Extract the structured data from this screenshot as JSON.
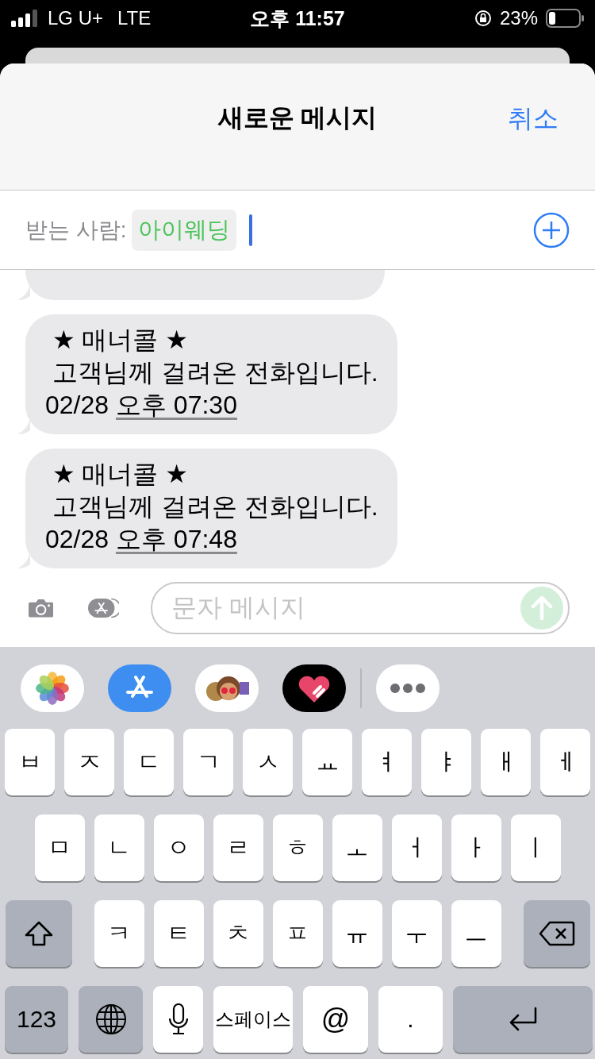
{
  "status_bar": {
    "carrier": "LG U+",
    "network": "LTE",
    "time": "오후 11:57",
    "battery": "23%"
  },
  "header": {
    "title": "새로운 메시지",
    "cancel": "취소"
  },
  "recipient": {
    "label": "받는 사람:",
    "chips": [
      "아이웨딩"
    ]
  },
  "messages": [
    {
      "text": " ★ 매너콜 ★\n 고객님께 걸려온 전화입니다.",
      "date": "02/28",
      "time": "오후 07:30"
    },
    {
      "text": " ★ 매너콜 ★\n 고객님께 걸려온 전화입니다.",
      "date": "02/28",
      "time": "오후 07:48"
    }
  ],
  "composer": {
    "placeholder": "문자 메시지"
  },
  "keyboard": {
    "rows": [
      [
        "ㅂ",
        "ㅈ",
        "ㄷ",
        "ㄱ",
        "ㅅ",
        "ㅛ",
        "ㅕ",
        "ㅑ",
        "ㅐ",
        "ㅔ"
      ],
      [
        "ㅁ",
        "ㄴ",
        "ㅇ",
        "ㄹ",
        "ㅎ",
        "ㅗ",
        "ㅓ",
        "ㅏ",
        "ㅣ"
      ],
      [
        "ㅋ",
        "ㅌ",
        "ㅊ",
        "ㅍ",
        "ㅠ",
        "ㅜ",
        "ㅡ"
      ]
    ],
    "numbers": "123",
    "space": "스페이스",
    "at": "@",
    "dot": "."
  }
}
